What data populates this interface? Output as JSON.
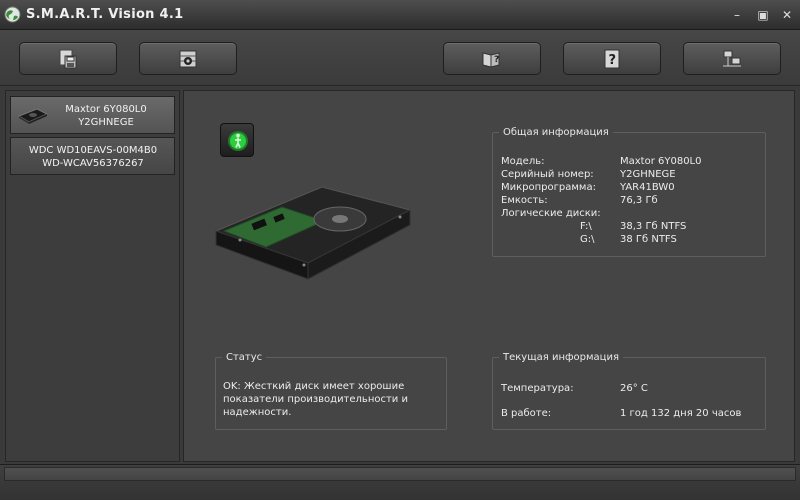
{
  "window": {
    "title": "S.M.A.R.T. Vision 4.1",
    "icons": {
      "app": "globe-icon",
      "minimize": "minimize-icon",
      "maximize": "maximize-icon",
      "close": "close-icon"
    }
  },
  "toolbar": {
    "buttons": [
      {
        "icon": "save-report-icon"
      },
      {
        "icon": "settings-icon"
      },
      {
        "icon": "help-book-icon"
      },
      {
        "icon": "question-icon"
      },
      {
        "icon": "network-icon"
      }
    ]
  },
  "sidebar": {
    "disks": [
      {
        "line1": "Maxtor 6Y080L0",
        "line2": "Y2GHNEGE",
        "icon": "hdd-icon",
        "selected": true
      },
      {
        "line1": "WDC WD10EAVS-00M4B0",
        "line2": "WD-WCAV56376267",
        "selected": false
      }
    ]
  },
  "main": {
    "status_light": {
      "icon": "status-ok-icon",
      "color": "#2ecc40"
    },
    "general": {
      "legend": "Общая информация",
      "model_label": "Модель:",
      "model": "Maxtor 6Y080L0",
      "serial_label": "Серийный номер:",
      "serial": "Y2GHNEGE",
      "firmware_label": "Микропрограмма:",
      "firmware": "YAR41BW0",
      "capacity_label": "Емкость:",
      "capacity": "76,3 Гб",
      "logical_label": "Логические диски:",
      "drives": [
        {
          "letter": "F:\\",
          "info": "38,3 Гб  NTFS"
        },
        {
          "letter": "G:\\",
          "info": "38 Гб  NTFS"
        }
      ]
    },
    "status": {
      "legend": "Статус",
      "text": "OK: Жесткий диск имеет хорошие показатели производительности и надежности."
    },
    "current": {
      "legend": "Текущая информация",
      "temp_label": "Температура:",
      "temp": "26° C",
      "uptime_label": "В работе:",
      "uptime": "1 год 132 дня 20 часов"
    }
  }
}
